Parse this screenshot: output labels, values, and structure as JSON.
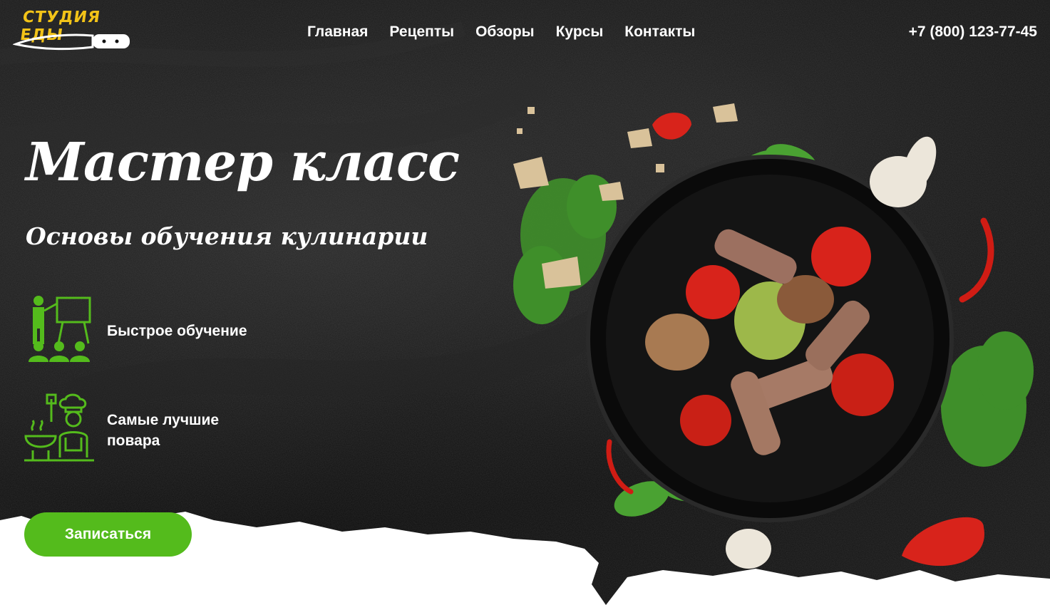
{
  "header": {
    "logo_text": "СТУДИЯ ЕДЫ",
    "nav": [
      "Главная",
      "Рецепты",
      "Обзоры",
      "Курсы",
      "Контакты"
    ],
    "phone": "+7 (800) 123-77-45"
  },
  "hero": {
    "title": "Мастер класс",
    "subtitle": "Основы обучения кулинарии",
    "features": [
      {
        "icon": "teacher-presentation-icon",
        "label": "Быстрое обучение"
      },
      {
        "icon": "chef-cooking-icon",
        "label": "Самые лучшие повара"
      }
    ],
    "cta_label": "Записаться",
    "image": "food-bowl-image"
  },
  "colors": {
    "accent": "#54bb1c",
    "logo": "#f2c318",
    "background": "#111111",
    "text": "#ffffff"
  }
}
